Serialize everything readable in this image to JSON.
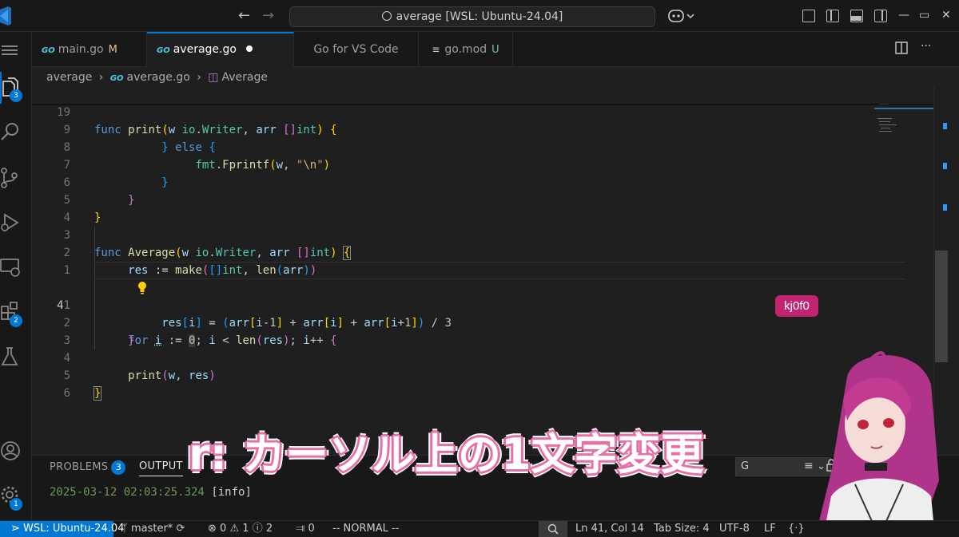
{
  "titlebar": {
    "search_text": "average [WSL: Ubuntu-24.04]"
  },
  "activity_bar": {
    "explorer_badge": "3",
    "extensions_badge": "2",
    "settings_badge": "1"
  },
  "tabs": [
    {
      "icon": "GO",
      "label": "main.go",
      "status": "M"
    },
    {
      "icon": "GO",
      "label": "average.go"
    },
    {
      "label": "Go for VS Code"
    },
    {
      "label": "go.mod",
      "status": "U"
    }
  ],
  "breadcrumb": {
    "folder": "average",
    "file": "average.go",
    "symbol": "Average"
  },
  "editor": {
    "sticky_line_number": "19",
    "line_numbers": [
      "9",
      "8",
      "7",
      "6",
      "5",
      "4",
      "3",
      "2",
      "1",
      "41",
      "1",
      "2",
      "3",
      "4",
      "5",
      "6"
    ],
    "current_line_number": "41"
  },
  "tag": {
    "text": "kj0f0"
  },
  "panel": {
    "problems_label": "PROBLEMS",
    "problems_count": "3",
    "output_label": "OUTPUT",
    "output_channel": "G",
    "log_timestamp": "2025-03-12 02:03:25.324",
    "log_level": "[info]"
  },
  "caption": {
    "text": "r: カーソル上の1文字変更"
  },
  "statusbar": {
    "remote": "WSL: Ubuntu-24.04",
    "branch": "master*",
    "errors": "0",
    "warnings": "1",
    "infos": "2",
    "ports": "0",
    "mode": "-- NORMAL --",
    "cursor_position": "Ln 41, Col 14",
    "tab_size": "Tab Size: 4",
    "encoding": "UTF-8",
    "eol": "LF"
  },
  "colors": {
    "accent": "#0078d4",
    "tag_bg": "#c2256f",
    "caption_outline": "#e76fa7"
  }
}
